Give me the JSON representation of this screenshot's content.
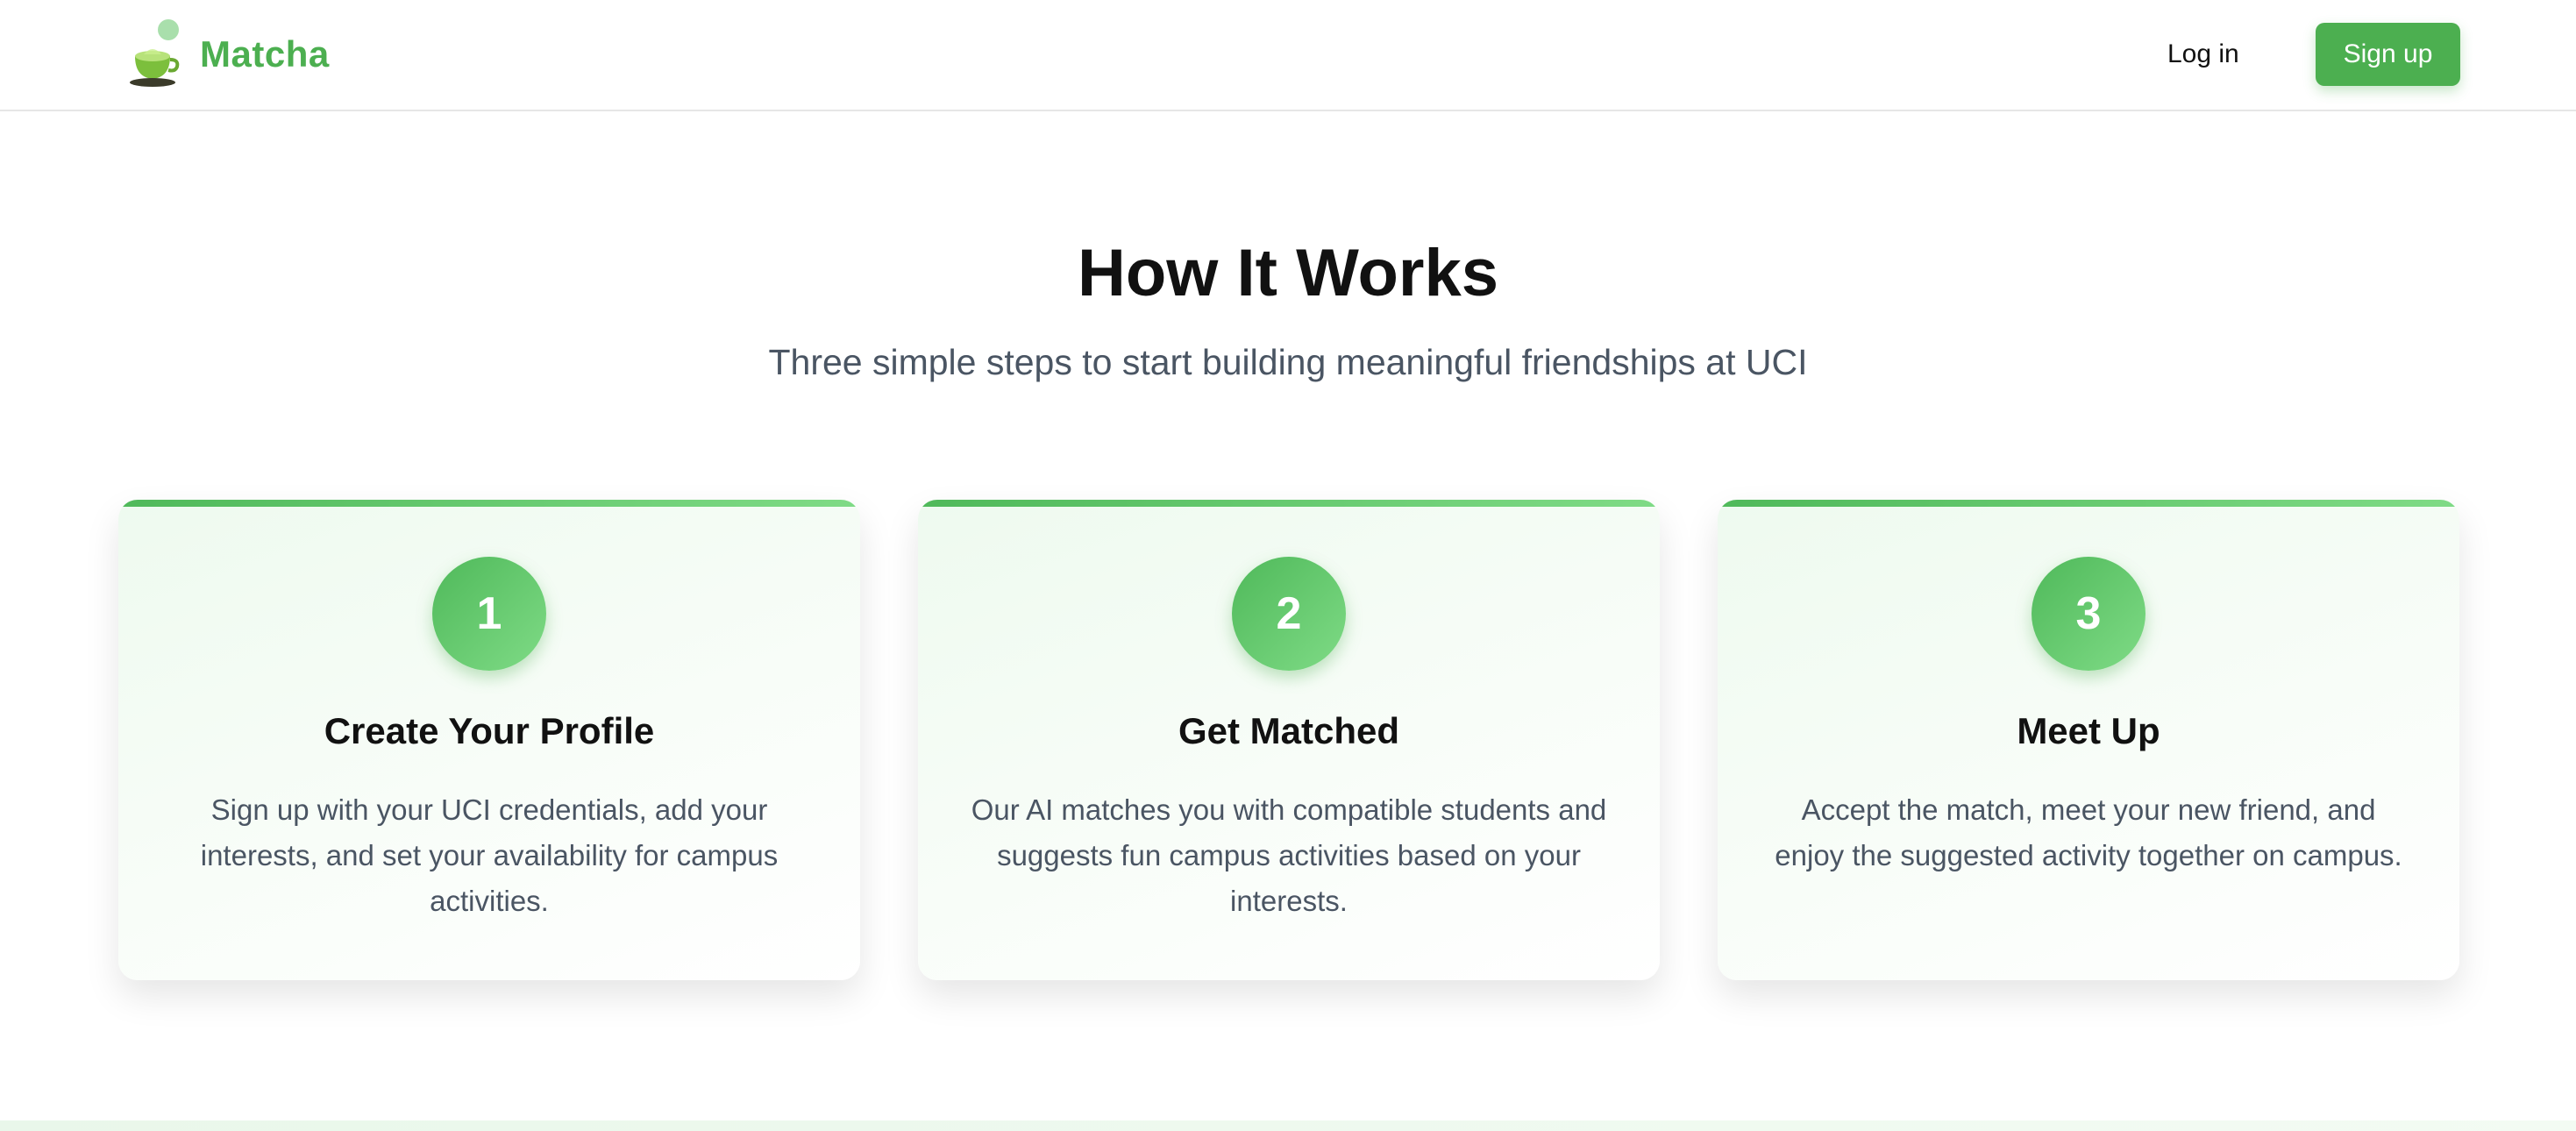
{
  "brand": {
    "name": "Matcha",
    "logo_icon": "matcha-cup-icon",
    "accent": "#4caf50"
  },
  "nav": {
    "login_label": "Log in",
    "signup_label": "Sign up"
  },
  "section": {
    "title": "How It Works",
    "subtitle": "Three simple steps to start building meaningful friendships at UCI"
  },
  "steps": [
    {
      "number": "1",
      "title": "Create Your Profile",
      "description": "Sign up with your UCI credentials, add your interests, and set your availability for campus activities."
    },
    {
      "number": "2",
      "title": "Get Matched",
      "description": "Our AI matches you with compatible students and suggests fun campus activities based on your interests."
    },
    {
      "number": "3",
      "title": "Meet Up",
      "description": "Accept the match, meet your new friend, and enjoy the suggested activity together on campus."
    }
  ],
  "colors": {
    "green_primary": "#4caf50",
    "green_light": "#7fdb86",
    "text_dark": "#111111",
    "text_muted": "#4a5563"
  }
}
